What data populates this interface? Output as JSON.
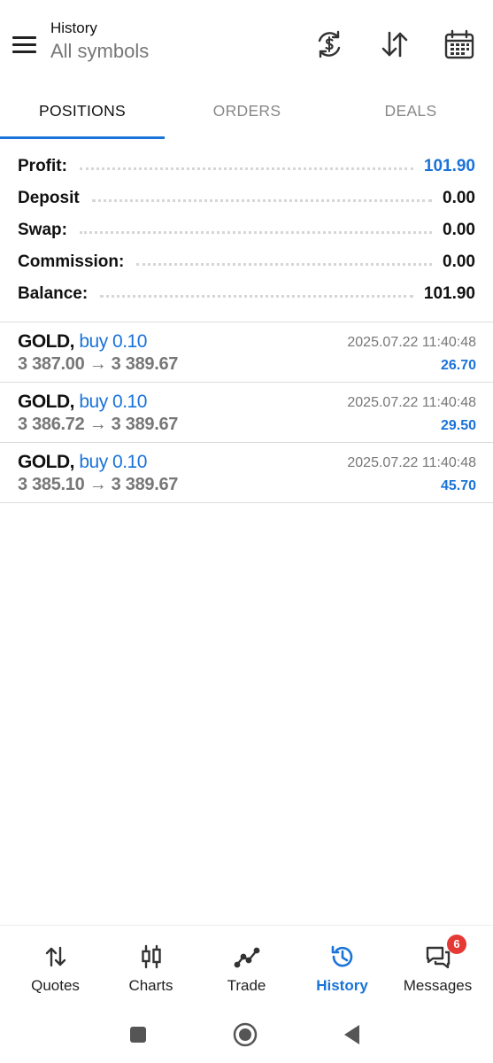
{
  "header": {
    "title": "History",
    "subtitle": "All symbols",
    "icons": [
      "menu-icon",
      "currency-exchange-icon",
      "sort-icon",
      "calendar-icon"
    ]
  },
  "tabs": [
    {
      "label": "POSITIONS",
      "active": true
    },
    {
      "label": "ORDERS",
      "active": false
    },
    {
      "label": "DEALS",
      "active": false
    }
  ],
  "summary": {
    "profit": {
      "label": "Profit:",
      "value": "101.90"
    },
    "deposit": {
      "label": "Deposit",
      "value": "0.00"
    },
    "swap": {
      "label": "Swap:",
      "value": "0.00"
    },
    "commission": {
      "label": "Commission:",
      "value": "0.00"
    },
    "balance": {
      "label": "Balance:",
      "value": "101.90"
    }
  },
  "deals": [
    {
      "symbol": "GOLD,",
      "side": "buy 0.10",
      "prices": "3 387.00 → 3 389.67",
      "time": "2025.07.22 11:40:48",
      "profit": "26.70"
    },
    {
      "symbol": "GOLD,",
      "side": "buy 0.10",
      "prices": "3 386.72 → 3 389.67",
      "time": "2025.07.22 11:40:48",
      "profit": "29.50"
    },
    {
      "symbol": "GOLD,",
      "side": "buy 0.10",
      "prices": "3 385.10 → 3 389.67",
      "time": "2025.07.22 11:40:48",
      "profit": "45.70"
    }
  ],
  "bottom_nav": [
    {
      "label": "Quotes",
      "icon": "quotes-icon",
      "active": false
    },
    {
      "label": "Charts",
      "icon": "candlestick-icon",
      "active": false
    },
    {
      "label": "Trade",
      "icon": "trade-line-icon",
      "active": false
    },
    {
      "label": "History",
      "icon": "history-icon",
      "active": true
    },
    {
      "label": "Messages",
      "icon": "messages-icon",
      "active": false,
      "badge": "6"
    }
  ],
  "colors": {
    "accent": "#1a73d9",
    "badge": "#e53935",
    "muted": "#777777"
  }
}
